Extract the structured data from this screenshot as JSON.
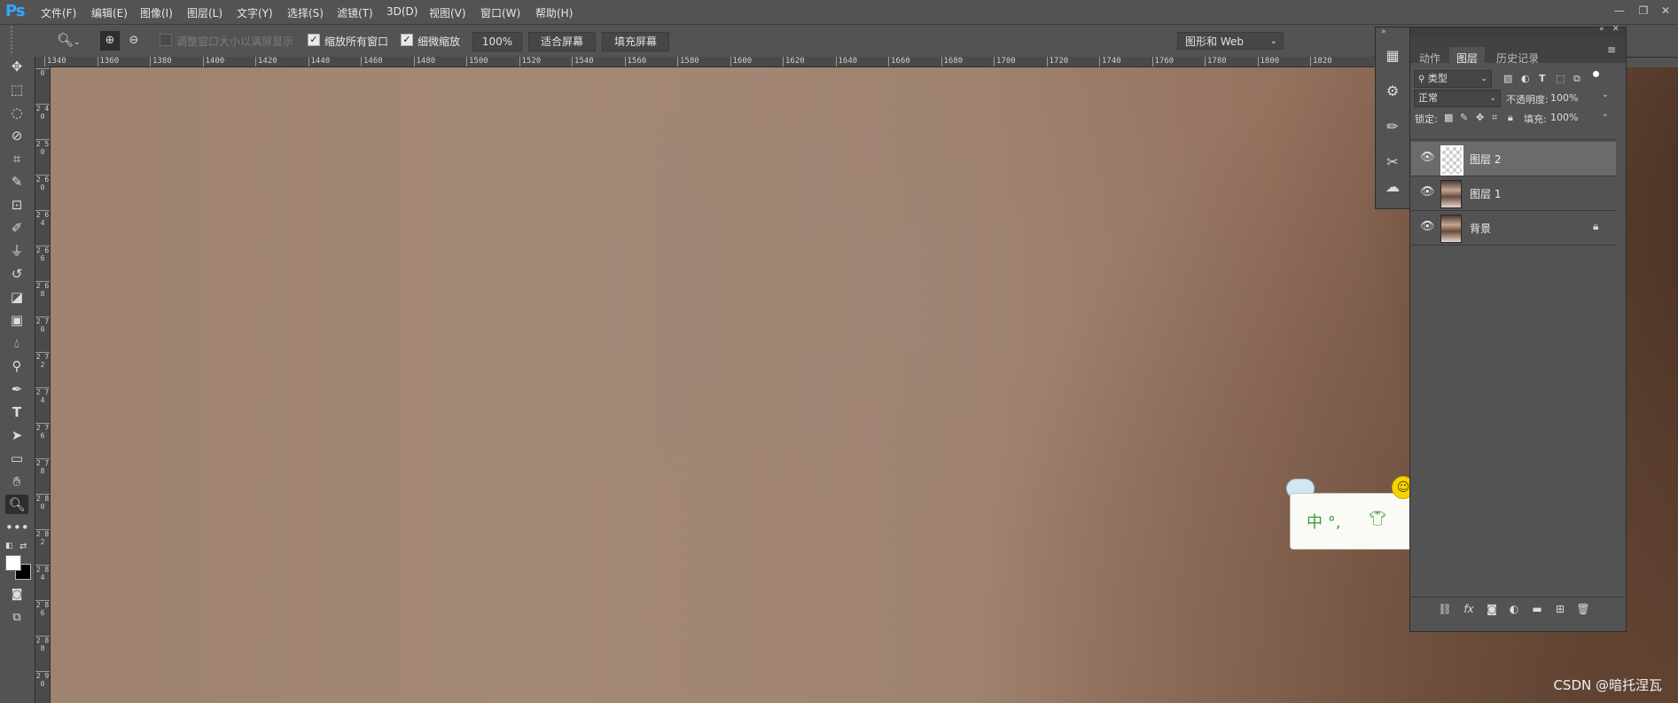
{
  "app": {
    "logo": "Ps"
  },
  "menu": [
    "文件(F)",
    "编辑(E)",
    "图像(I)",
    "图层(L)",
    "文字(Y)",
    "选择(S)",
    "滤镜(T)",
    "3D(D)",
    "视图(V)",
    "窗口(W)",
    "帮助(H)"
  ],
  "options": {
    "resize_windows": "调整窗口大小以满屏显示",
    "zoom_all_windows": "缩放所有窗口",
    "scrubby_zoom": "细微缩放",
    "zoom_value": "100%",
    "fit_screen": "适合屏幕",
    "fill_screen": "填充屏幕",
    "workspace": "图形和 Web"
  },
  "ruler": {
    "h_ticks": [
      "1340",
      "1360",
      "1380",
      "1400",
      "1420",
      "1440",
      "1460",
      "1480",
      "1500",
      "1520",
      "1540",
      "1560",
      "1580",
      "1600",
      "1620",
      "1640",
      "1660",
      "1680",
      "1700",
      "1720",
      "1740",
      "1760",
      "1780",
      "1800",
      "1820"
    ],
    "v_ticks": [
      "0",
      "2 4 0",
      "2 5 0",
      "2 6 0",
      "2 6 4",
      "2 6 6",
      "2 6 8",
      "2 7 0",
      "2 7 2",
      "2 7 4",
      "2 7 6",
      "2 7 8",
      "2 8 0",
      "2 8 2",
      "2 8 4",
      "2 8 6",
      "2 8 8",
      "2 9 0"
    ]
  },
  "layers_panel": {
    "tabs": [
      "动作",
      "图层",
      "历史记录"
    ],
    "filter_kind": "类型",
    "blend_mode": "正常",
    "opacity_label": "不透明度:",
    "opacity_value": "100%",
    "lock_label": "锁定:",
    "fill_label": "填充:",
    "fill_value": "100%",
    "layers": [
      {
        "name": "图层 2",
        "selected": true,
        "locked": false
      },
      {
        "name": "图层 1",
        "selected": false,
        "locked": false
      },
      {
        "name": "背景",
        "selected": false,
        "locked": true
      }
    ]
  },
  "ime": {
    "text": "中 °,"
  },
  "watermark": "CSDN @暗托涅瓦"
}
